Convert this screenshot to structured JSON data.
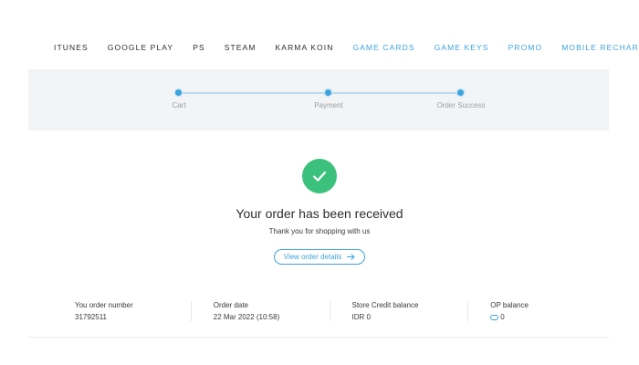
{
  "nav": {
    "items": [
      {
        "label": "ITUNES",
        "accent": false
      },
      {
        "label": "GOOGLE PLAY",
        "accent": false
      },
      {
        "label": "PS",
        "accent": false
      },
      {
        "label": "STEAM",
        "accent": false
      },
      {
        "label": "KARMA KOIN",
        "accent": false
      },
      {
        "label": "GAME CARDS",
        "accent": true
      },
      {
        "label": "GAME KEYS",
        "accent": true
      },
      {
        "label": "PROMO",
        "accent": true
      },
      {
        "label": "MOBILE RECHARGE",
        "accent": true
      }
    ]
  },
  "stepper": {
    "steps": [
      {
        "label": "Cart"
      },
      {
        "label": "Payment"
      },
      {
        "label": "Order Success"
      }
    ]
  },
  "success": {
    "icon": "check-icon",
    "title": "Your order has been received",
    "subtitle": "Thank you for shopping with us",
    "details_label": "View order details",
    "details_icon": "arrow-right-icon"
  },
  "summary": {
    "order_number_label": "You order number",
    "order_number": "31792511",
    "order_date_label": "Order date",
    "order_date": "22 Mar 2022 (10:58)",
    "store_credit_label": "Store Credit balance",
    "store_credit": "IDR 0",
    "op_balance_label": "OP balance",
    "op_balance": "0",
    "op_icon": "op-coin-icon"
  },
  "colors": {
    "accent": "#3ba3df",
    "success": "#3cc17c",
    "band": "#f3f4f6"
  }
}
